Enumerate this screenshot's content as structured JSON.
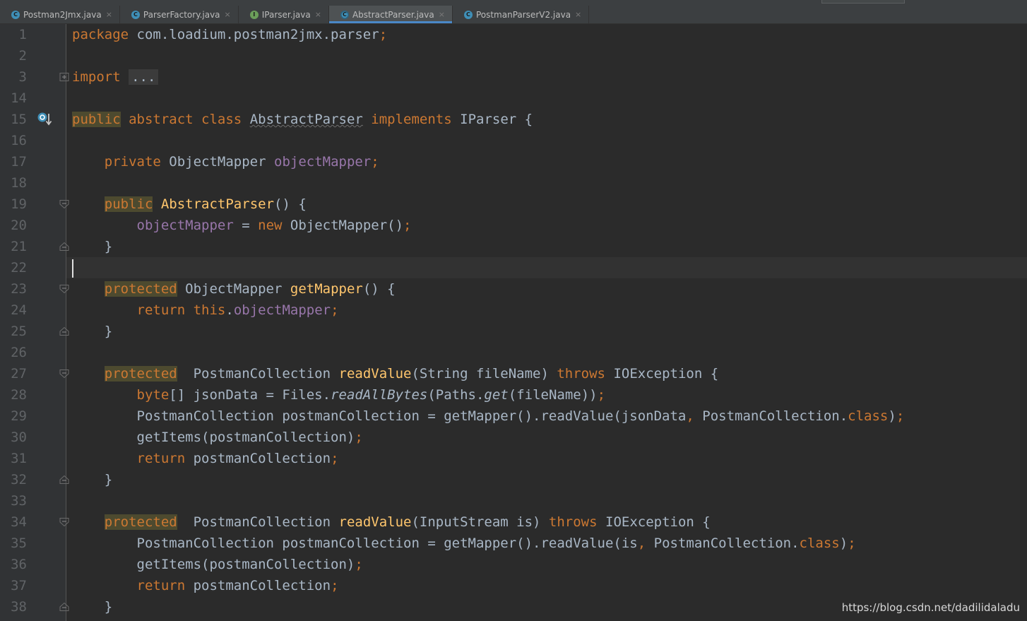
{
  "tabs": [
    {
      "label": "Postman2Jmx.java",
      "icon": "class-icon",
      "active": false
    },
    {
      "label": "ParserFactory.java",
      "icon": "class-icon",
      "active": false
    },
    {
      "label": "IParser.java",
      "icon": "interface-icon",
      "active": false
    },
    {
      "label": "AbstractParser.java",
      "icon": "abstract-class-icon",
      "active": true
    },
    {
      "label": "PostmanParserV2.java",
      "icon": "class-icon",
      "active": false
    }
  ],
  "tab_close_glyph": "×",
  "code": {
    "l1": {
      "n": "1",
      "package": "package",
      "pkg": " com.loadium.postman2jmx.parser",
      "semi": ";"
    },
    "l2": {
      "n": "2"
    },
    "l3": {
      "n": "3",
      "import": "import",
      "sp": " ",
      "folded": "..."
    },
    "l14": {
      "n": "14"
    },
    "l15": {
      "n": "15",
      "public": "public",
      "abstract": " abstract",
      "class": " class",
      "sp": " ",
      "name": "AbstractParser",
      "implements": " implements",
      "rest": " IParser {"
    },
    "l16": {
      "n": "16"
    },
    "l17": {
      "n": "17",
      "indent": "    ",
      "private": "private",
      "type": " ObjectMapper ",
      "field": "objectMapper",
      "semi": ";"
    },
    "l18": {
      "n": "18"
    },
    "l19": {
      "n": "19",
      "indent": "    ",
      "public": "public",
      "sp": " ",
      "ctor": "AbstractParser",
      "rest": "() {"
    },
    "l20": {
      "n": "20",
      "indent": "        ",
      "field": "objectMapper",
      "eq": " = ",
      "new": "new",
      "rest": " ObjectMapper()",
      "semi": ";"
    },
    "l21": {
      "n": "21",
      "indent": "    ",
      "rest": "}"
    },
    "l22": {
      "n": "22"
    },
    "l23": {
      "n": "23",
      "indent": "    ",
      "protected": "protected",
      "type": " ObjectMapper ",
      "method": "getMapper",
      "rest": "() {"
    },
    "l24": {
      "n": "24",
      "indent": "        ",
      "return": "return",
      "sp": " ",
      "this": "this",
      "dot": ".",
      "field": "objectMapper",
      "semi": ";"
    },
    "l25": {
      "n": "25",
      "indent": "    ",
      "rest": "}"
    },
    "l26": {
      "n": "26"
    },
    "l27": {
      "n": "27",
      "indent": "    ",
      "protected": "protected",
      "type": "  PostmanCollection ",
      "method": "readValue",
      "params": "(String fileName) ",
      "throws": "throws",
      "rest": " IOException {"
    },
    "l28": {
      "n": "28",
      "indent": "        ",
      "byte": "byte",
      "a": "[] jsonData = Files.",
      "m1": "readAllBytes",
      "b": "(Paths.",
      "m2": "get",
      "c": "(fileName))",
      "semi": ";"
    },
    "l29": {
      "n": "29",
      "indent": "        ",
      "a": "PostmanCollection postmanCollection = getMapper().readValue(jsonData",
      "comma": ",",
      "b": " PostmanCollection.",
      "class": "class",
      "c": ")",
      "semi": ";"
    },
    "l30": {
      "n": "30",
      "indent": "        ",
      "a": "getItems(postmanCollection)",
      "semi": ";"
    },
    "l31": {
      "n": "31",
      "indent": "        ",
      "return": "return",
      "a": " postmanCollection",
      "semi": ";"
    },
    "l32": {
      "n": "32",
      "indent": "    ",
      "rest": "}"
    },
    "l33": {
      "n": "33"
    },
    "l34": {
      "n": "34",
      "indent": "    ",
      "protected": "protected",
      "type": "  PostmanCollection ",
      "method": "readValue",
      "params": "(InputStream is) ",
      "throws": "throws",
      "rest": " IOException {"
    },
    "l35": {
      "n": "35",
      "indent": "        ",
      "a": "PostmanCollection postmanCollection = getMapper().readValue(is",
      "comma": ",",
      "b": " PostmanCollection.",
      "class": "class",
      "c": ")",
      "semi": ";"
    },
    "l36": {
      "n": "36",
      "indent": "        ",
      "a": "getItems(postmanCollection)",
      "semi": ";"
    },
    "l37": {
      "n": "37",
      "indent": "        ",
      "return": "return",
      "a": " postmanCollection",
      "semi": ";"
    },
    "l38": {
      "n": "38",
      "indent": "    ",
      "rest": "}"
    }
  },
  "watermark": "https://blog.csdn.net/dadilidaladu",
  "colors": {
    "background": "#2b2b2b",
    "keyword": "#cc7832",
    "field": "#9876aa",
    "method": "#ffc66d",
    "text": "#a9b7c6",
    "line_number": "#606366",
    "tab_accent": "#4a88c7"
  }
}
